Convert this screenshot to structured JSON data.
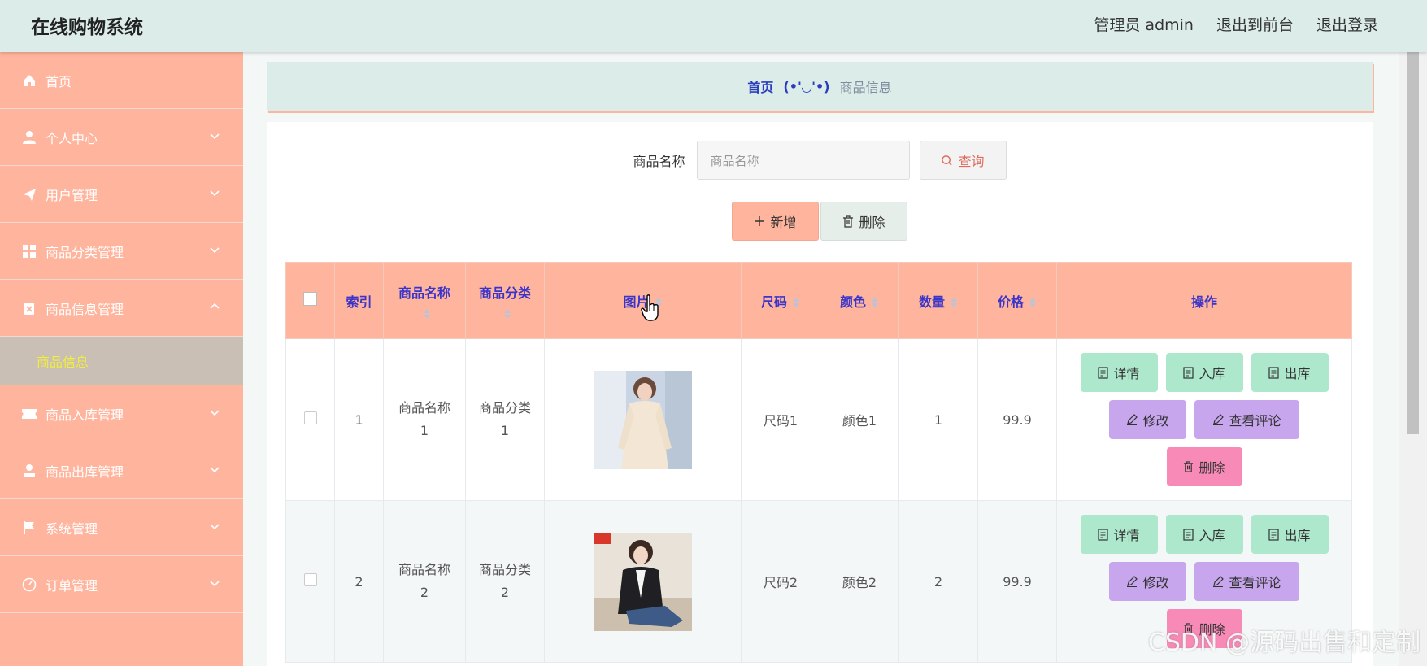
{
  "app": {
    "title": "在线购物系统"
  },
  "top_links": {
    "admin": "管理员 admin",
    "front": "退出到前台",
    "logout": "退出登录"
  },
  "sidebar": {
    "items": [
      {
        "label": "首页",
        "icon": "home-icon"
      },
      {
        "label": "个人中心",
        "icon": "user-icon"
      },
      {
        "label": "用户管理",
        "icon": "send-icon"
      },
      {
        "label": "商品分类管理",
        "icon": "grid-icon"
      },
      {
        "label": "商品信息管理",
        "icon": "clipboard-icon"
      },
      {
        "label": "商品入库管理",
        "icon": "ticket-icon"
      },
      {
        "label": "商品出库管理",
        "icon": "person-icon"
      },
      {
        "label": "系统管理",
        "icon": "flag-icon"
      },
      {
        "label": "订单管理",
        "icon": "gauge-icon"
      }
    ],
    "sub_active": "商品信息"
  },
  "breadcrumb": {
    "home": "首页",
    "sep": "(•'◡'•)",
    "current": "商品信息"
  },
  "search": {
    "label": "商品名称",
    "placeholder": "商品名称",
    "button": "查询"
  },
  "actions": {
    "add": "新增",
    "delete": "删除"
  },
  "table": {
    "headers": {
      "index": "索引",
      "name": "商品名称",
      "category": "商品分类",
      "image": "图片",
      "size": "尺码",
      "color": "颜色",
      "quantity": "数量",
      "price": "价格",
      "ops": "操作"
    },
    "rows": [
      {
        "index": "1",
        "name": "商品名称1",
        "category": "商品分类1",
        "size": "尺码1",
        "color": "颜色1",
        "quantity": "1",
        "price": "99.9"
      },
      {
        "index": "2",
        "name": "商品名称2",
        "category": "商品分类2",
        "size": "尺码2",
        "color": "颜色2",
        "quantity": "2",
        "price": "99.9"
      }
    ],
    "ops": {
      "detail": "详情",
      "in": "入库",
      "out": "出库",
      "edit": "修改",
      "review": "查看评论",
      "delete": "删除"
    }
  },
  "watermark": "CSDN @源码出售和定制",
  "colors": {
    "sidebar": "#ffb49d",
    "header_bg": "#dcece8",
    "accent_text": "#3a34c9",
    "green_btn": "#ade8cc",
    "purple_btn": "#c7a6ed",
    "pink_btn": "#f78ab6"
  }
}
